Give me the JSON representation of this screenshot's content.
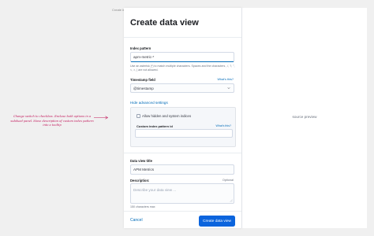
{
  "canvas": {
    "frame_label": "Create index pattern - 01"
  },
  "annotation": {
    "text": "Change switch to checkbox. Enclose both options in a subdued panel. Move description of custom index pattern into a tooltip",
    "color": "#c2185b"
  },
  "flyout": {
    "title": "Create data view",
    "index_pattern": {
      "label": "Index pattern",
      "value": "apm-metric-*",
      "help": "Use an asterisk (*) to match multiple characters. Spaces and the characters , /, ?, \", <, >, | are not allowed."
    },
    "timestamp": {
      "label": "Timestamp field",
      "link": "What's this?",
      "value": "@timestamp",
      "icon": "chevron-down-icon"
    },
    "advanced": {
      "toggle_label": "Hide advanced settings",
      "checkbox_label": "Allow hidden and system indices",
      "custom_id_label": "Custom index pattern id",
      "custom_id_link": "What's this?",
      "custom_id_value": ""
    },
    "data_view_title": {
      "label": "Data view title",
      "value": "APM Metrics"
    },
    "description": {
      "label": "Description:",
      "optional": "Optional",
      "placeholder": "Describe your data view ...",
      "counter": "150 characters max"
    },
    "footer": {
      "cancel_label": "Cancel",
      "submit_label": "Create data view"
    }
  },
  "preview": {
    "label": "source preview"
  },
  "colors": {
    "accent": "#006bb8",
    "primary": "#0b64dd",
    "annotation": "#c2185b"
  }
}
